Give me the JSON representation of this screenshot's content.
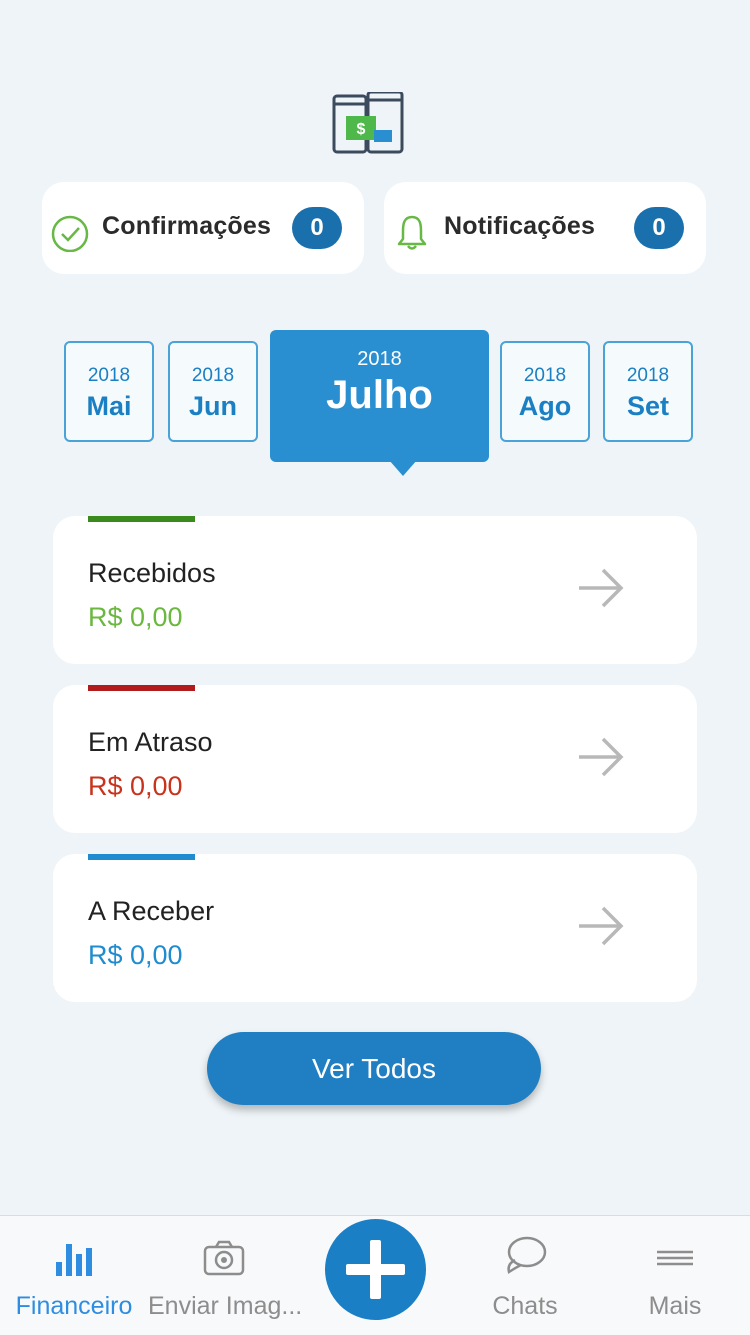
{
  "header": {
    "logo_icon": "phones-money-icon"
  },
  "status": {
    "confirmations": {
      "label": "Confirmações",
      "count": "0",
      "icon": "check-circle-icon"
    },
    "notifications": {
      "label": "Notificações",
      "count": "0",
      "icon": "bell-icon"
    }
  },
  "months": [
    {
      "year": "2018",
      "month": "Mai"
    },
    {
      "year": "2018",
      "month": "Jun"
    },
    {
      "year": "2018",
      "month": "Julho",
      "selected": true
    },
    {
      "year": "2018",
      "month": "Ago"
    },
    {
      "year": "2018",
      "month": "Set"
    }
  ],
  "cards": [
    {
      "title": "Recebidos",
      "amount": "R$ 0,00",
      "color": "#6ab83f",
      "bar_color": "#3a8a1e"
    },
    {
      "title": "Em Atraso",
      "amount": "R$ 0,00",
      "color": "#c9331c",
      "bar_color": "#b21b1b"
    },
    {
      "title": "A Receber",
      "amount": "R$ 0,00",
      "color": "#1f8ccf",
      "bar_color": "#1f8ccf"
    }
  ],
  "actions": {
    "view_all": "Ver Todos"
  },
  "tabbar": {
    "items": [
      {
        "label": "Financeiro",
        "icon": "bar-chart-icon",
        "active": true
      },
      {
        "label": "Enviar Imag...",
        "icon": "camera-icon"
      },
      {
        "label": "",
        "icon": "plus-icon"
      },
      {
        "label": "Chats",
        "icon": "chat-bubble-icon"
      },
      {
        "label": "Mais",
        "icon": "menu-icon"
      }
    ]
  },
  "colors": {
    "accent": "#1a7fc4",
    "background": "#eef4f7",
    "active_tab": "#2e8de0"
  }
}
